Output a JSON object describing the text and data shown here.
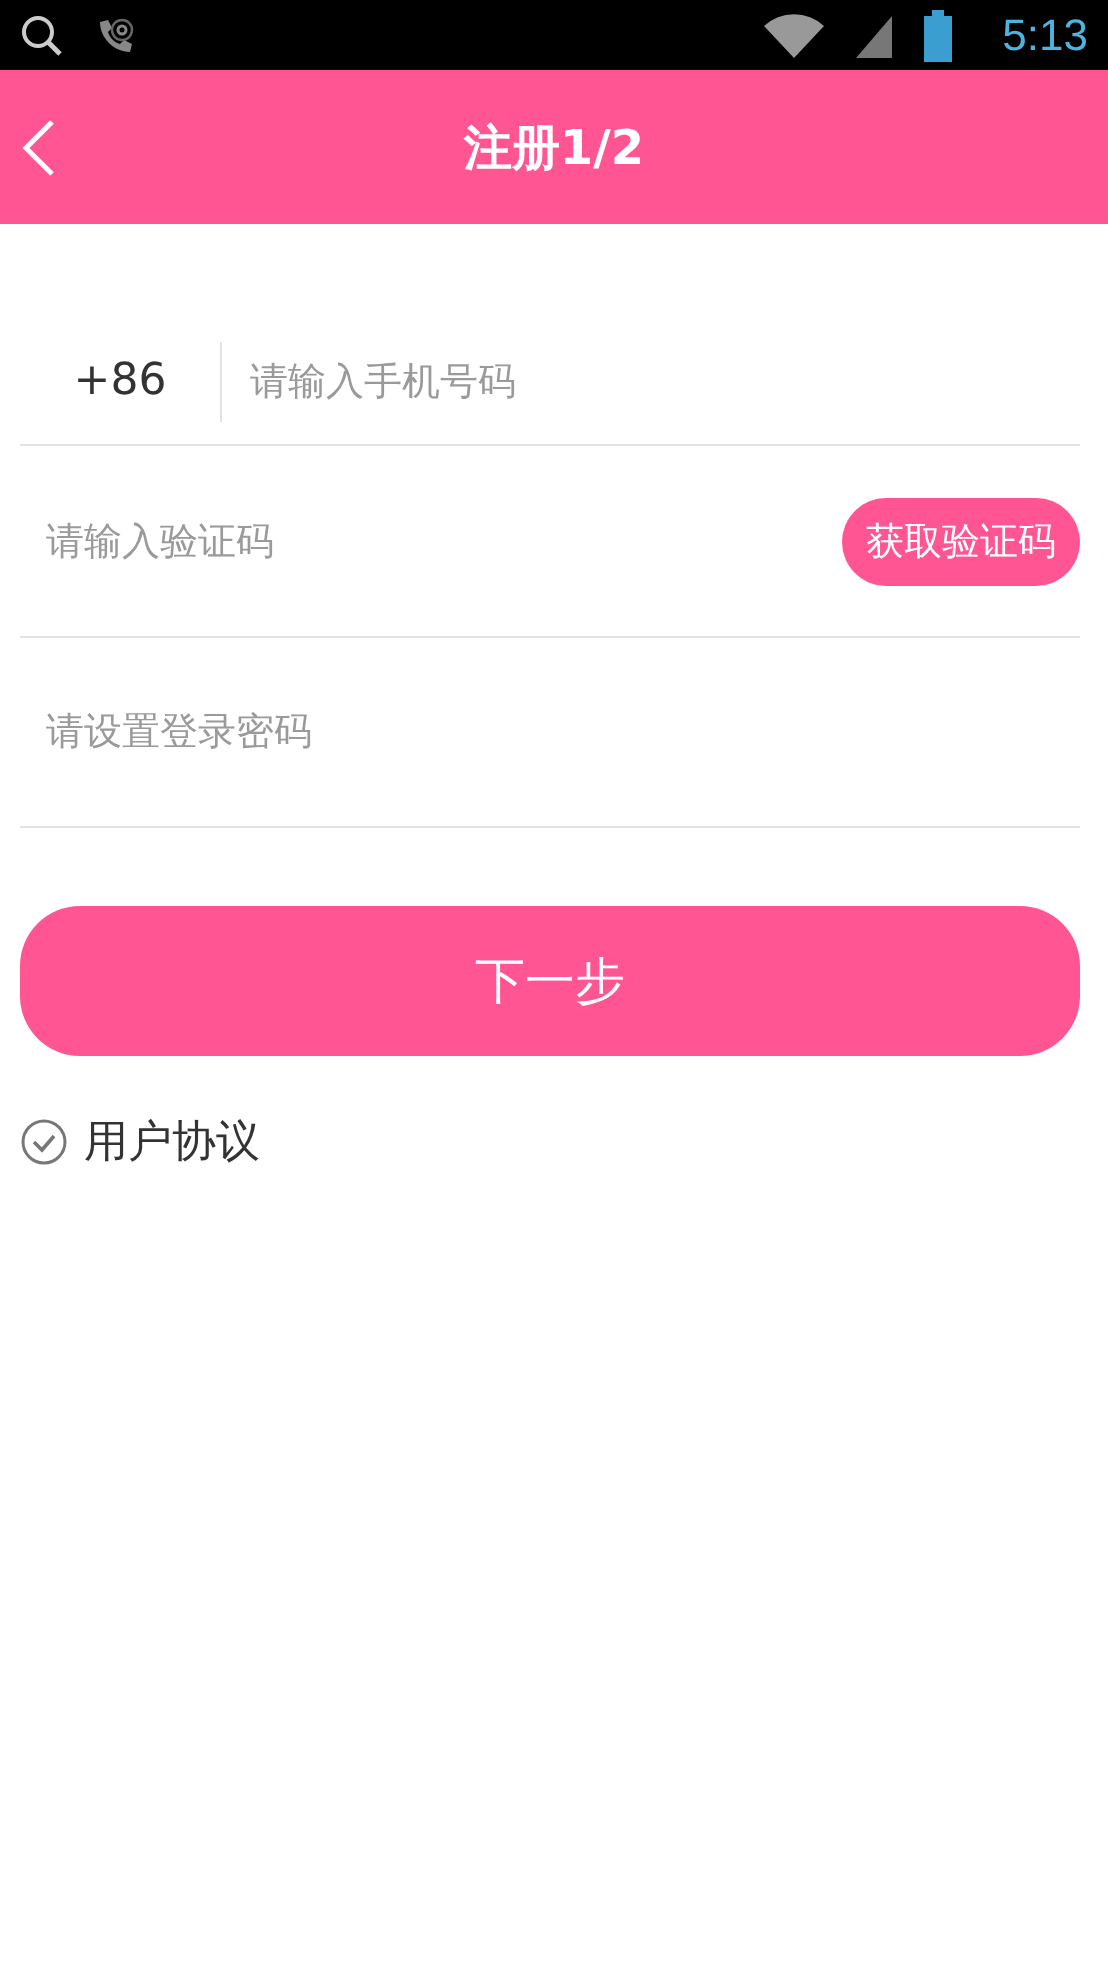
{
  "status_bar": {
    "time": "5:13"
  },
  "header": {
    "title": "注册1/2"
  },
  "phone": {
    "country_code": "+86",
    "placeholder": "请输入手机号码"
  },
  "code": {
    "placeholder": "请输入验证码",
    "button": "获取验证码"
  },
  "password": {
    "placeholder": "请设置登录密码"
  },
  "next_button": "下一步",
  "agreement": {
    "label": "用户协议",
    "checked": true
  }
}
